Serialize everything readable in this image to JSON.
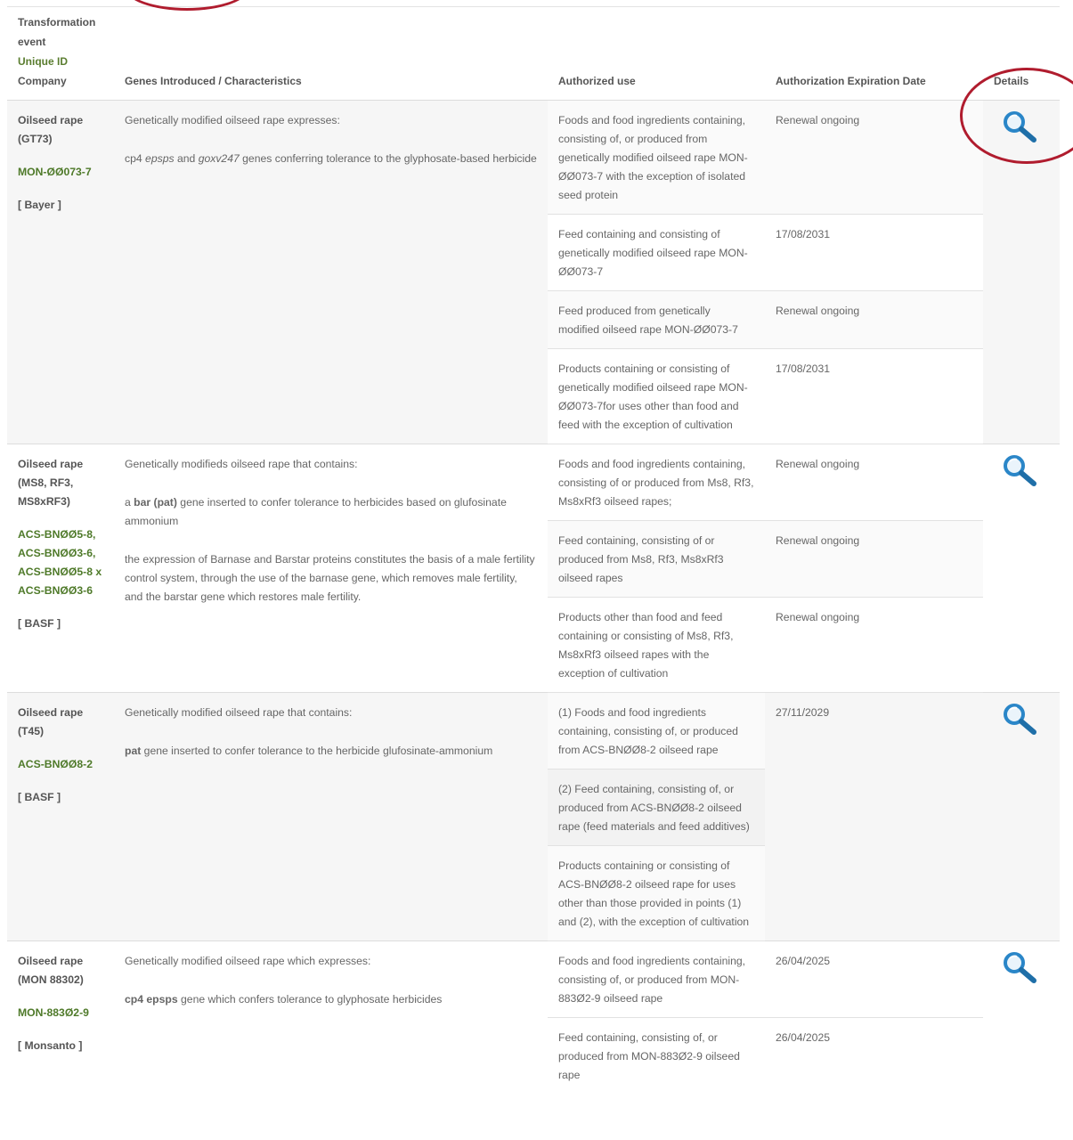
{
  "header": {
    "col1": [
      "Transformation",
      "event",
      "Unique ID",
      "Company"
    ],
    "col2": "Genes Introduced / Characteristics",
    "col3": "Authorized use",
    "col4": "Authorization Expiration Date",
    "col5": "Details"
  },
  "rows": [
    {
      "event": "Oilseed rape (GT73)",
      "uid": "MON-ØØ073-7",
      "company": "[ Bayer ]",
      "gene_intro": "Genetically modified oilseed rape expresses:",
      "gene_detail_pre": "cp4 ",
      "gene_detail_em1": "epsps",
      "gene_detail_mid": " and ",
      "gene_detail_em2": "goxv247",
      "gene_detail_post": " genes conferring tolerance to the glyphosate-based herbicide",
      "uses": [
        {
          "use": "Foods and food ingredients containing, consisting of, or produced from genetically modified oilseed rape MON-ØØ073-7 with the exception of isolated seed protein",
          "date": "Renewal ongoing"
        },
        {
          "use": "Feed containing and consisting of genetically modified oilseed rape MON-ØØ073-7",
          "date": "17/08/2031"
        },
        {
          "use": "Feed produced from genetically modified oilseed rape MON-ØØ073-7",
          "date": "Renewal ongoing"
        },
        {
          "use": "Products containing or consisting of genetically modified oilseed rape MON-ØØ073-7for uses other than food and feed with the exception of cultivation",
          "date": "17/08/2031"
        }
      ]
    },
    {
      "event": "Oilseed rape (MS8, RF3, MS8xRF3)",
      "uid": "ACS-BNØØ5-8, ACS-BNØØ3-6, ACS-BNØØ5-8 x ACS-BNØØ3-6",
      "company": "[ BASF ]",
      "gene_intro": "Genetically modifieds oilseed rape that contains:",
      "gene_p2_pre": "a ",
      "gene_p2_bold": "bar (pat)",
      "gene_p2_post": " gene inserted to confer tolerance to herbicides based on glufosinate ammonium",
      "gene_p3": "the expression of Barnase and Barstar proteins constitutes the basis of a male fertility control system, through the use of the barnase gene, which removes male fertility, and the barstar gene which restores male fertility.",
      "uses": [
        {
          "use": "Foods and food ingredients containing, consisting of or produced from Ms8, Rf3, Ms8xRf3 oilseed rapes;",
          "date": "Renewal ongoing"
        },
        {
          "use": "Feed containing, consisting of or produced from Ms8, Rf3, Ms8xRf3 oilseed rapes",
          "date": "Renewal ongoing"
        },
        {
          "use": "Products other than food and feed containing or consisting of Ms8, Rf3, Ms8xRf3 oilseed rapes with the exception of cultivation",
          "date": "Renewal ongoing"
        }
      ]
    },
    {
      "event": "Oilseed rape (T45)",
      "uid": "ACS-BNØØ8-2",
      "company": "[ BASF ]",
      "gene_intro": "Genetically modified oilseed rape that contains:",
      "gene_p2_bold": "pat",
      "gene_p2_post": " gene inserted to confer tolerance to the herbicide glufosinate-ammonium",
      "uses": [
        {
          "use": "(1) Foods and food ingredients containing, consisting of, or produced from ACS-BNØØ8-2 oilseed rape",
          "date": "27/11/2029"
        },
        {
          "use": "(2) Feed containing, consisting of, or produced from ACS-BNØØ8-2 oilseed rape (feed materials and feed additives)",
          "date": ""
        },
        {
          "use": "Products containing or consisting of ACS-BNØØ8-2 oilseed rape for uses other than those provided in points (1) and (2), with the exception of cultivation",
          "date": ""
        }
      ]
    },
    {
      "event": "Oilseed rape (MON 88302)",
      "uid": "MON-883Ø2-9",
      "company": "[ Monsanto ]",
      "gene_intro": "Genetically modified oilseed rape which expresses:",
      "gene_p2_bold": "cp4 epsps",
      "gene_p2_post": " gene which confers tolerance to glyphosate herbicides",
      "uses": [
        {
          "use": "Foods and food ingredients containing, consisting of, or produced from MON-883Ø2-9 oilseed rape",
          "date": "26/04/2025"
        },
        {
          "use": "Feed containing, consisting of, or produced from MON-883Ø2-9 oilseed rape",
          "date": "26/04/2025"
        }
      ]
    }
  ],
  "icons": {
    "details": "magnifier-icon"
  },
  "colors": {
    "highlight_circle": "#b01c2e",
    "unique_id": "#4f7a2a",
    "icon_blue": "#2a86c8"
  }
}
